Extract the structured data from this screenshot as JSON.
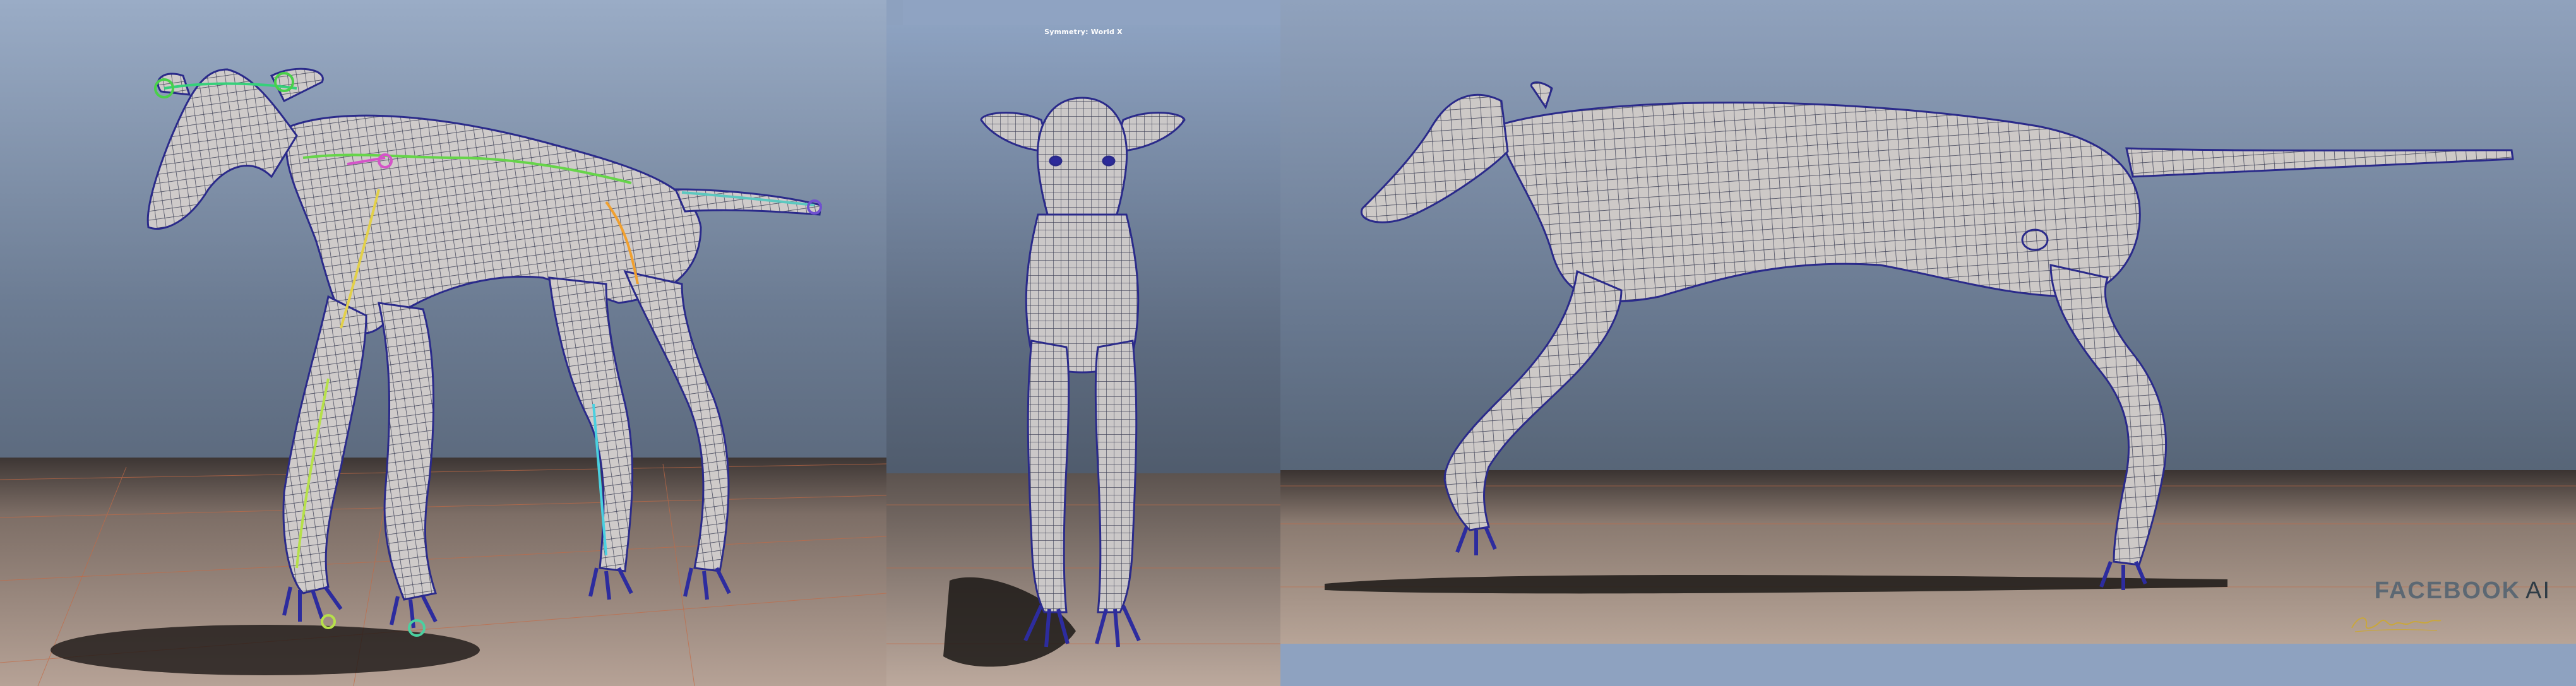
{
  "viewport": {
    "center_title": "Symmetry: World X"
  },
  "branding": {
    "company": "FACEBOOK",
    "suffix": "AI"
  },
  "colors": {
    "sky_top": "#9aabc5",
    "sky_bottom": "#5f6f86",
    "floor": "#a08f82",
    "mesh_body": "#cfcccb",
    "mesh_wire": "#3a3f5a",
    "mesh_edge": "#26279a",
    "brand": "#5c6873"
  },
  "icons": {
    "signature": "artist-signature-icon"
  }
}
